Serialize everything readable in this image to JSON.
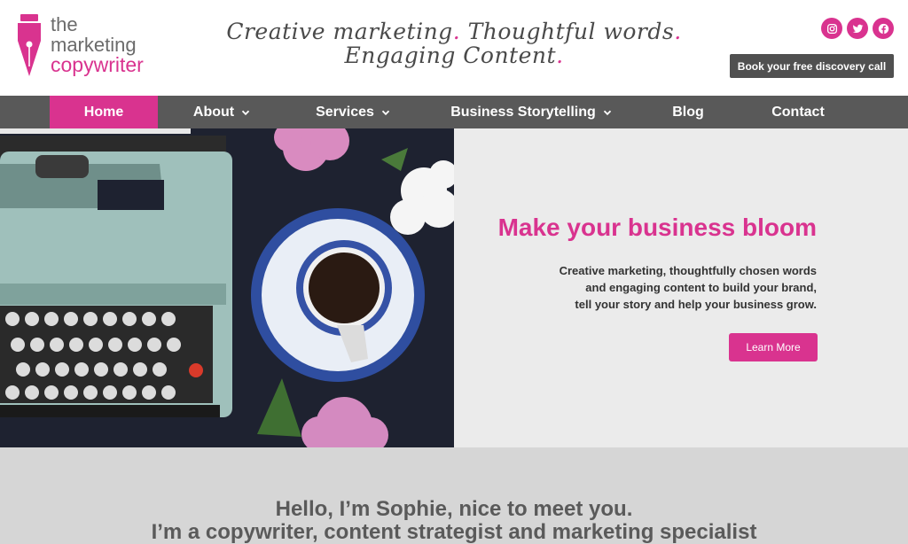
{
  "brand": {
    "logo_line1": "the",
    "logo_line2": "marketing",
    "logo_line3": "copywriter",
    "accent_color": "#d9338f",
    "nav_bg_color": "#595959"
  },
  "header": {
    "tagline_part1": "Creative marketing",
    "tagline_part2": "Thoughtful words",
    "tagline_part3": "Engaging Content",
    "social": [
      {
        "name": "instagram-icon"
      },
      {
        "name": "twitter-icon"
      },
      {
        "name": "facebook-icon"
      }
    ],
    "cta_label": "Book your free discovery call"
  },
  "nav": {
    "items": [
      {
        "label": "Home",
        "active": true,
        "has_dropdown": false
      },
      {
        "label": "About",
        "active": false,
        "has_dropdown": true
      },
      {
        "label": "Services",
        "active": false,
        "has_dropdown": true
      },
      {
        "label": "Business Storytelling",
        "active": false,
        "has_dropdown": true
      },
      {
        "label": "Blog",
        "active": false,
        "has_dropdown": false
      },
      {
        "label": "Contact",
        "active": false,
        "has_dropdown": false
      }
    ]
  },
  "hero": {
    "title": "Make your business bloom",
    "subtitle_line1": "Creative marketing, thoughtfully chosen words",
    "subtitle_line2": "and engaging content to build your brand,",
    "subtitle_line3": "tell your story and help your business grow.",
    "button_label": "Learn More"
  },
  "intro": {
    "line1": "Hello, I’m Sophie, nice to meet you.",
    "line2": "I’m a copywriter, content strategist and marketing specialist"
  }
}
